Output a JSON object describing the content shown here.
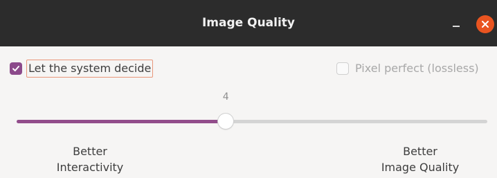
{
  "window": {
    "title": "Image Quality",
    "minimize_icon": "minimize-icon",
    "close_icon": "close-icon"
  },
  "options": {
    "auto_label": "Let the system decide",
    "auto_checked": true,
    "lossless_label": "Pixel perfect (lossless)",
    "lossless_checked": false,
    "lossless_enabled": false
  },
  "slider": {
    "value": "4",
    "min": 0,
    "max": 9,
    "left_caption_line1": "Better",
    "left_caption_line2": "Interactivity",
    "right_caption_line1": "Better",
    "right_caption_line2": "Image Quality"
  },
  "colors": {
    "accent": "#924d8b",
    "close": "#e95420",
    "titlebar": "#2c2c2c"
  }
}
